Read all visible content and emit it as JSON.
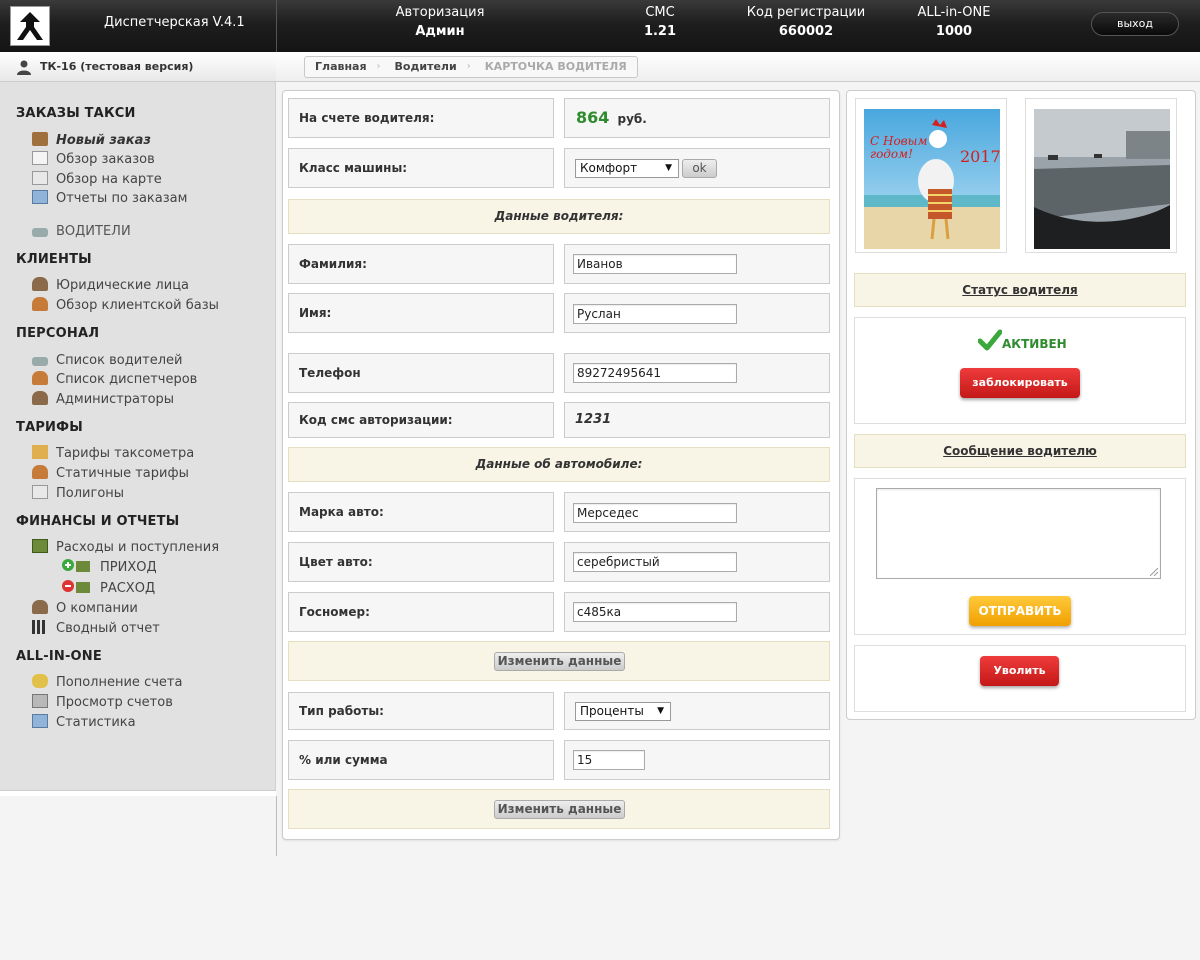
{
  "header": {
    "app_title": "Диспетчерская V.4.1",
    "stats": [
      {
        "label": "Авторизация",
        "value": "Админ"
      },
      {
        "label": "СМС",
        "value": "1.21"
      },
      {
        "label": "Код регистрации",
        "value": "660002"
      },
      {
        "label": "ALL-in-ONE",
        "value": "1000"
      }
    ],
    "logout_label": "выход"
  },
  "user": {
    "name": "ТК-16 (тестовая версия)"
  },
  "breadcrumb": [
    "Главная",
    "Водители",
    "КАРТОЧКА ВОДИТЕЛЯ"
  ],
  "sidebar": {
    "sections": [
      {
        "title": "ЗАКАЗЫ ТАКСИ",
        "items": [
          "Новый заказ",
          "Обзор заказов",
          "Обзор на карте",
          "Отчеты по заказам"
        ]
      },
      {
        "title": "",
        "items": [
          "ВОДИТЕЛИ"
        ]
      },
      {
        "title": "КЛИЕНТЫ",
        "items": [
          "Юридические лица",
          "Обзор клиентской базы"
        ]
      },
      {
        "title": "ПЕРСОНАЛ",
        "items": [
          "Список водителей",
          "Список диспетчеров",
          "Администраторы"
        ]
      },
      {
        "title": "ТАРИФЫ",
        "items": [
          "Тарифы таксометра",
          "Статичные тарифы",
          "Полигоны"
        ]
      },
      {
        "title": "ФИНАНСЫ И ОТЧЕТЫ",
        "items": [
          "Расходы и поступления",
          "ПРИХОД",
          "РАСХОД",
          "О компании",
          "Сводный отчет"
        ]
      },
      {
        "title": "ALL-IN-ONE",
        "items": [
          "Пополнение счета",
          "Просмотр счетов",
          "Статистика"
        ]
      }
    ]
  },
  "driver": {
    "balance_label": "На счете водителя:",
    "balance_value": "864",
    "balance_currency": "руб.",
    "class_label": "Класс машины:",
    "class_value": "Комфорт",
    "ok_label": "ok",
    "driver_section": "Данные водителя:",
    "lastname_label": "Фамилия:",
    "lastname_value": "Иванов",
    "firstname_label": "Имя:",
    "firstname_value": "Руслан",
    "phone_label": "Телефон",
    "phone_value": "89272495641",
    "sms_label": "Код смс авторизации:",
    "sms_value": "1231",
    "car_section": "Данные об автомобиле:",
    "brand_label": "Марка авто:",
    "brand_value": "Мерседес",
    "color_label": "Цвет авто:",
    "color_value": "серебристый",
    "plate_label": "Госномер:",
    "plate_value": "с485ка",
    "change_label": "Изменить данные",
    "worktype_label": "Тип работы:",
    "worktype_value": "Проценты",
    "percent_label": "% или сумма",
    "percent_value": "15"
  },
  "side": {
    "photo1_text": "С Новым годом!",
    "photo1_year": "2017",
    "status_head": "Статус водителя",
    "status_text": "АКТИВЕН",
    "block_label": "заблокировать",
    "message_head": "Сообщение водителю",
    "send_label": "ОТПРАВИТЬ",
    "fire_label": "Уволить"
  },
  "colors": {
    "accent_green": "#2e8b2e",
    "danger": "#d92222",
    "warning": "#f5aa10"
  }
}
